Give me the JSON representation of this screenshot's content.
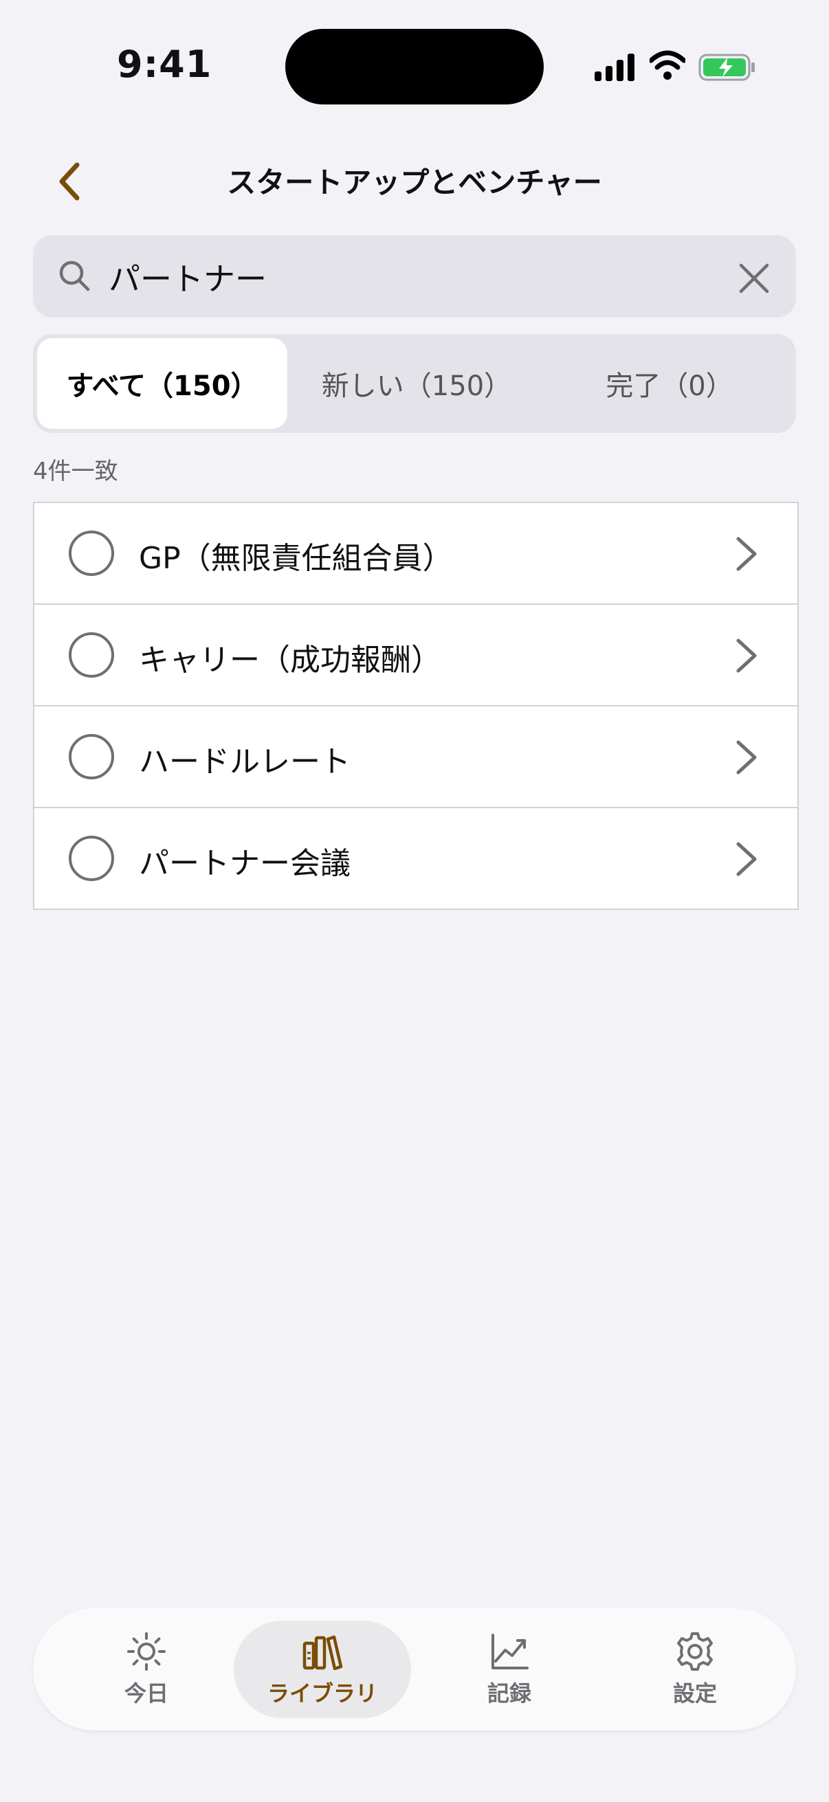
{
  "status_bar": {
    "time": "9:41"
  },
  "nav": {
    "title": "スタートアップとベンチャー"
  },
  "search": {
    "value": "パートナー",
    "placeholder": ""
  },
  "segments": [
    {
      "label": "すべて（150）",
      "selected": true
    },
    {
      "label": "新しい（150）",
      "selected": false
    },
    {
      "label": "完了（0）",
      "selected": false
    }
  ],
  "results": {
    "count_label": "4件一致"
  },
  "items": [
    {
      "label": "GP（無限責任組合員）",
      "completed": false
    },
    {
      "label": "キャリー（成功報酬）",
      "completed": false
    },
    {
      "label": "ハードルレート",
      "completed": false
    },
    {
      "label": "パートナー会議",
      "completed": false
    }
  ],
  "tabbar": {
    "today": "今日",
    "library": "ライブラリ",
    "records": "記録",
    "settings": "設定"
  },
  "colors": {
    "accent": "#7A4D06",
    "background": "#F2F2F7"
  },
  "icons": [
    "back-chevron-icon",
    "search-icon",
    "clear-icon",
    "radio-circle-icon",
    "chevron-right-icon",
    "sun-icon",
    "books-icon",
    "chart-icon",
    "gear-icon"
  ]
}
